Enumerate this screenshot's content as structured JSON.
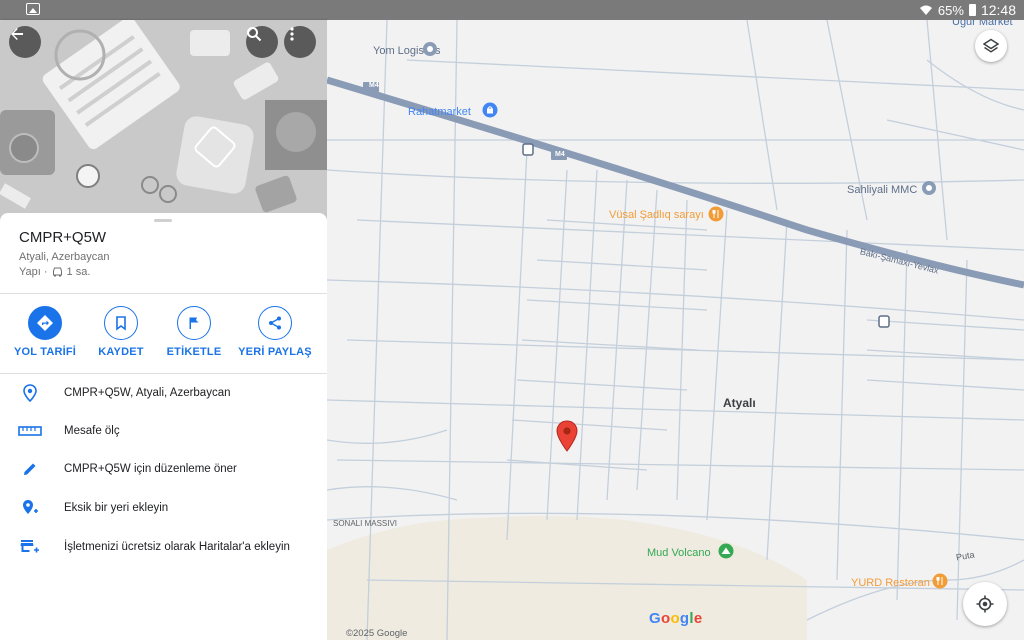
{
  "status_bar": {
    "battery": "65%",
    "time": "12:48"
  },
  "place": {
    "code": "CMPR+Q5W",
    "locality": "Atyali, Azerbaycan",
    "category": "Yapı ·",
    "drive_time": "1 sa."
  },
  "actions": [
    {
      "label": "YOL TARİFİ",
      "icon": "directions-icon"
    },
    {
      "label": "KAYDET",
      "icon": "bookmark-icon"
    },
    {
      "label": "ETİKETLE",
      "icon": "flag-icon"
    },
    {
      "label": "YERİ PAYLAŞ",
      "icon": "share-icon"
    }
  ],
  "menu": [
    {
      "label": "CMPR+Q5W, Atyali, Azerbaycan",
      "icon": "location-pin-icon"
    },
    {
      "label": "Mesafe ölç",
      "icon": "ruler-icon"
    },
    {
      "label": "CMPR+Q5W için düzenleme öner",
      "icon": "edit-pencil-icon"
    },
    {
      "label": "Eksik bir yeri ekleyin",
      "icon": "add-location-icon"
    },
    {
      "label": "İşletmenizi ücretsiz olarak Haritalar'a ekleyin",
      "icon": "add-business-icon"
    }
  ],
  "map": {
    "labels": {
      "ugur_market": "Uğur Market",
      "yom_logistics": "Yom Logistics",
      "rahat_market": "Rahatmarket",
      "sahliyali": "Sahliyali MMC",
      "vusal": "Vüsal Şadlıq sarayı",
      "road": "Bakı-Şamaxı-Yevlax",
      "town": "Atyalı",
      "sonali": "SONALI MASSIVI",
      "mud_volcano": "Mud Volcano",
      "yurd": "YURD Restoran",
      "puta": "Puta",
      "m4_a": "M4",
      "m4_b": "M4"
    },
    "google": "Google",
    "copyright": "©2025 Google"
  },
  "colors": {
    "accent": "#1a73e8",
    "road_main": "#8a9bb5",
    "street": "#c4cfdc",
    "pin": "#ea4335",
    "poi_blue": "#4285f4",
    "poi_orange": "#f29c38",
    "park_green": "#34a853"
  }
}
